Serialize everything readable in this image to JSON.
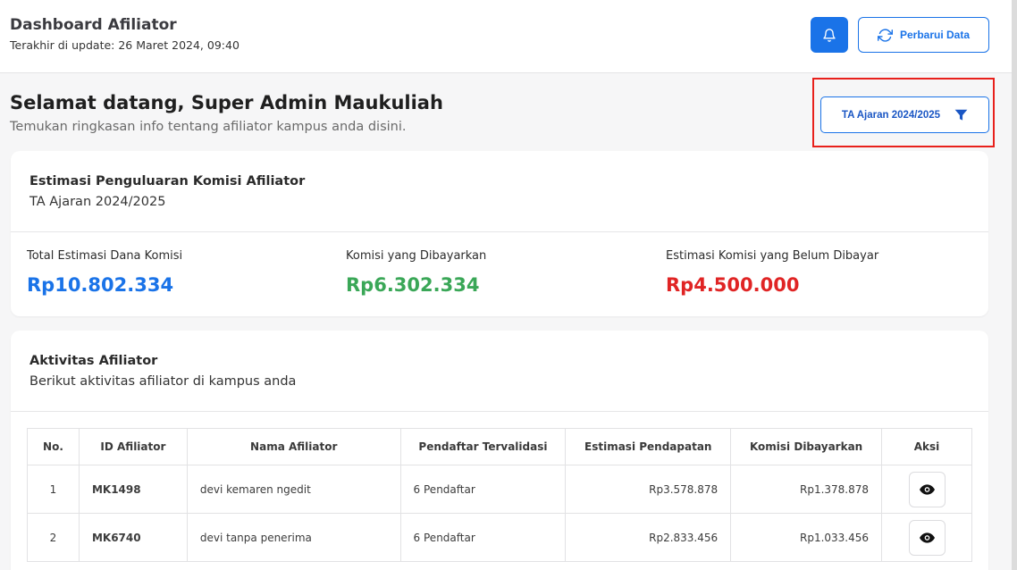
{
  "header": {
    "title": "Dashboard Afiliator",
    "last_update": "Terakhir di update: 26 Maret 2024, 09:40",
    "refresh_label": "Perbarui Data"
  },
  "welcome": {
    "title": "Selamat datang, Super Admin Maukuliah",
    "subtitle": "Temukan ringkasan info tentang afiliator kampus anda disini."
  },
  "filter": {
    "label": "TA Ajaran 2024/2025"
  },
  "commission_card": {
    "title": "Estimasi Penguluaran Komisi Afiliator",
    "subtitle": "TA Ajaran 2024/2025",
    "stats": [
      {
        "label": "Total Estimasi Dana Komisi",
        "value": "Rp10.802.334",
        "color": "#1a73e8"
      },
      {
        "label": "Komisi yang Dibayarkan",
        "value": "Rp6.302.334",
        "color": "#3aa757"
      },
      {
        "label": "Estimasi Komisi yang Belum Dibayar",
        "value": "Rp4.500.000",
        "color": "#e02424"
      }
    ]
  },
  "activity_card": {
    "title": "Aktivitas Afiliator",
    "subtitle": "Berikut aktivitas afiliator di kampus anda",
    "columns": [
      "No.",
      "ID Afiliator",
      "Nama Afiliator",
      "Pendaftar Tervalidasi",
      "Estimasi Pendapatan",
      "Komisi Dibayarkan",
      "Aksi"
    ],
    "rows": [
      {
        "no": "1",
        "id": "MK1498",
        "name": "devi kemaren ngedit",
        "registrants": "6 Pendaftar",
        "estimated": "Rp3.578.878",
        "paid": "Rp1.378.878"
      },
      {
        "no": "2",
        "id": "MK6740",
        "name": "devi tanpa penerima",
        "registrants": "6 Pendaftar",
        "estimated": "Rp2.833.456",
        "paid": "Rp1.033.456"
      }
    ]
  },
  "colors": {
    "accent": "#1a73e8",
    "highlight": "#e8201b"
  }
}
